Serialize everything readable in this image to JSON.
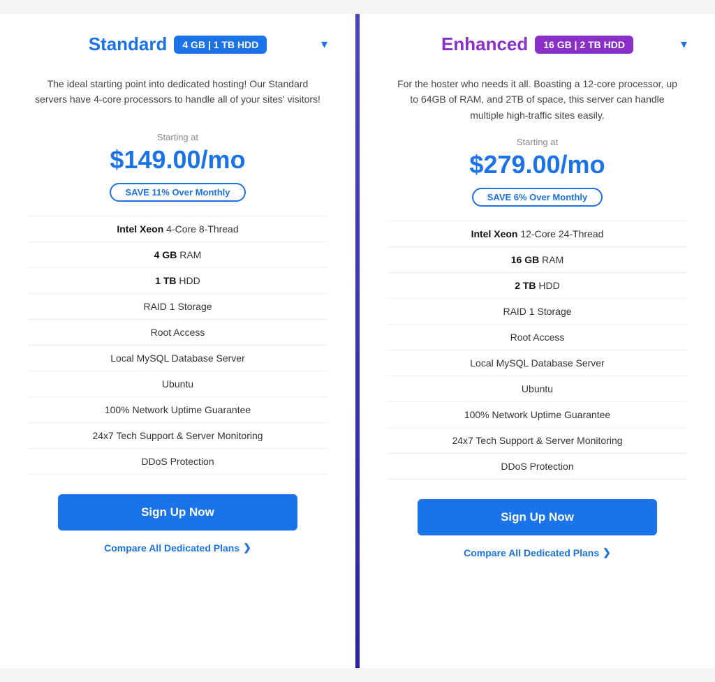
{
  "plans": [
    {
      "id": "standard",
      "name": "Standard",
      "name_color": "standard",
      "badge_text": "4 GB | 1 TB HDD",
      "badge_class": "badge-standard",
      "description": "The ideal starting point into dedicated hosting! Our Standard servers have 4-core processors to handle all of your sites' visitors!",
      "starting_at_label": "Starting at",
      "price": "$149.00/mo",
      "save_text": "SAVE 11% Over Monthly",
      "features": [
        {
          "bold": "Intel Xeon",
          "regular": " 4-Core 8-Thread"
        },
        {
          "bold": "4 GB",
          "regular": " RAM"
        },
        {
          "bold": "1 TB",
          "regular": " HDD"
        },
        {
          "bold": "",
          "regular": "RAID 1 Storage"
        },
        {
          "bold": "",
          "regular": "Root Access"
        },
        {
          "bold": "",
          "regular": "Local MySQL Database Server"
        },
        {
          "bold": "",
          "regular": "Ubuntu"
        },
        {
          "bold": "",
          "regular": "100% Network Uptime Guarantee"
        },
        {
          "bold": "",
          "regular": "24x7 Tech Support & Server Monitoring"
        },
        {
          "bold": "",
          "regular": "DDoS Protection"
        }
      ],
      "signup_label": "Sign Up Now",
      "compare_label": "Compare All Dedicated Plans"
    },
    {
      "id": "enhanced",
      "name": "Enhanced",
      "name_color": "enhanced",
      "badge_text": "16 GB | 2 TB HDD",
      "badge_class": "badge-enhanced",
      "description": "For the hoster who needs it all. Boasting a 12-core processor, up to 64GB of RAM, and 2TB of space, this server can handle multiple high-traffic sites easily.",
      "starting_at_label": "Starting at",
      "price": "$279.00/mo",
      "save_text": "SAVE 6% Over Monthly",
      "features": [
        {
          "bold": "Intel Xeon",
          "regular": " 12-Core 24-Thread"
        },
        {
          "bold": "16 GB",
          "regular": " RAM"
        },
        {
          "bold": "2 TB",
          "regular": " HDD"
        },
        {
          "bold": "",
          "regular": "RAID 1 Storage"
        },
        {
          "bold": "",
          "regular": "Root Access"
        },
        {
          "bold": "",
          "regular": "Local MySQL Database Server"
        },
        {
          "bold": "",
          "regular": "Ubuntu"
        },
        {
          "bold": "",
          "regular": "100% Network Uptime Guarantee"
        },
        {
          "bold": "",
          "regular": "24x7 Tech Support & Server Monitoring"
        },
        {
          "bold": "",
          "regular": "DDoS Protection"
        }
      ],
      "signup_label": "Sign Up Now",
      "compare_label": "Compare All Dedicated Plans"
    }
  ]
}
